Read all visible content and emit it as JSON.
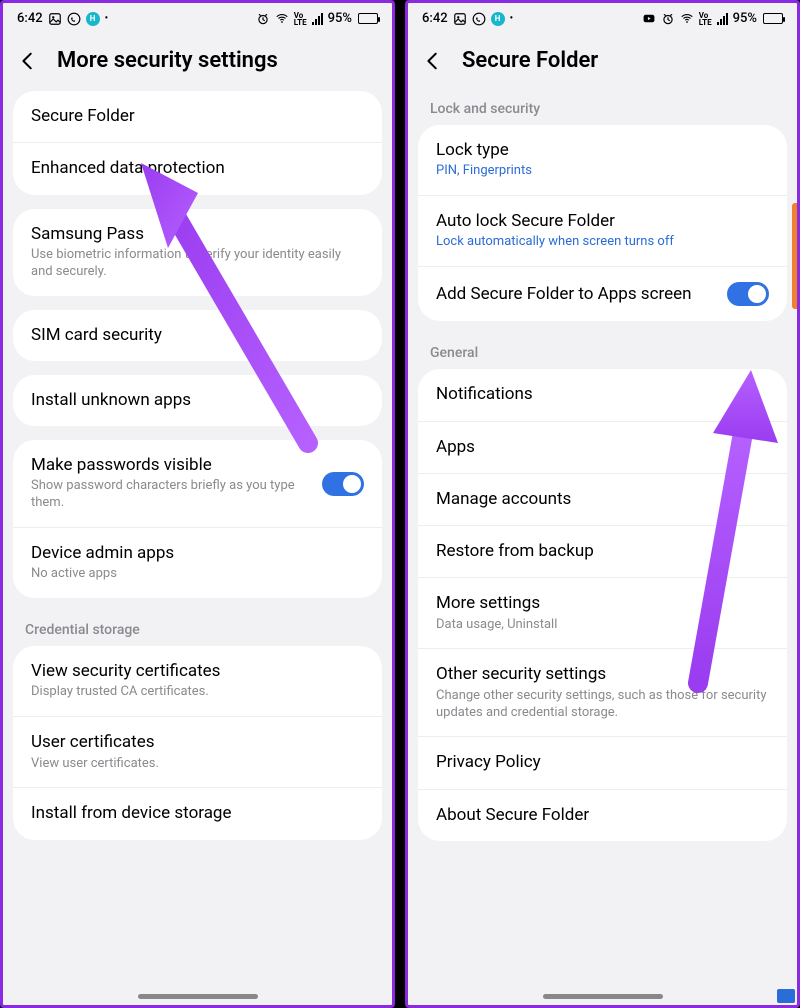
{
  "status": {
    "time": "6:42",
    "battery_pct": "95%"
  },
  "left": {
    "title": "More security settings",
    "group1": [
      {
        "title": "Secure Folder"
      },
      {
        "title": "Enhanced data protection"
      }
    ],
    "group2": [
      {
        "title": "Samsung Pass",
        "sub": "Use biometric information to verify your identity easily and securely."
      }
    ],
    "group3": [
      {
        "title": "SIM card security"
      }
    ],
    "group4": [
      {
        "title": "Install unknown apps"
      }
    ],
    "group5": [
      {
        "title": "Make passwords visible",
        "sub": "Show password characters briefly as you type them.",
        "toggle": true
      },
      {
        "title": "Device admin apps",
        "sub": "No active apps"
      }
    ],
    "section_cred": "Credential storage",
    "group6": [
      {
        "title": "View security certificates",
        "sub": "Display trusted CA certificates."
      },
      {
        "title": "User certificates",
        "sub": "View user certificates."
      },
      {
        "title": "Install from device storage"
      }
    ]
  },
  "right": {
    "title": "Secure Folder",
    "section_lock": "Lock and security",
    "group1": [
      {
        "title": "Lock type",
        "sub": "PIN, Fingerprints",
        "link": true
      },
      {
        "title": "Auto lock Secure Folder",
        "sub": "Lock automatically when screen turns off",
        "link": true
      },
      {
        "title": "Add Secure Folder to Apps screen",
        "toggle": true
      }
    ],
    "section_general": "General",
    "group2": [
      {
        "title": "Notifications"
      },
      {
        "title": "Apps"
      },
      {
        "title": "Manage accounts"
      },
      {
        "title": "Restore from backup"
      },
      {
        "title": "More settings",
        "sub": "Data usage, Uninstall"
      },
      {
        "title": "Other security settings",
        "sub": "Change other security settings, such as those for security updates and credential storage."
      },
      {
        "title": "Privacy Policy"
      },
      {
        "title": "About Secure Folder"
      }
    ]
  }
}
